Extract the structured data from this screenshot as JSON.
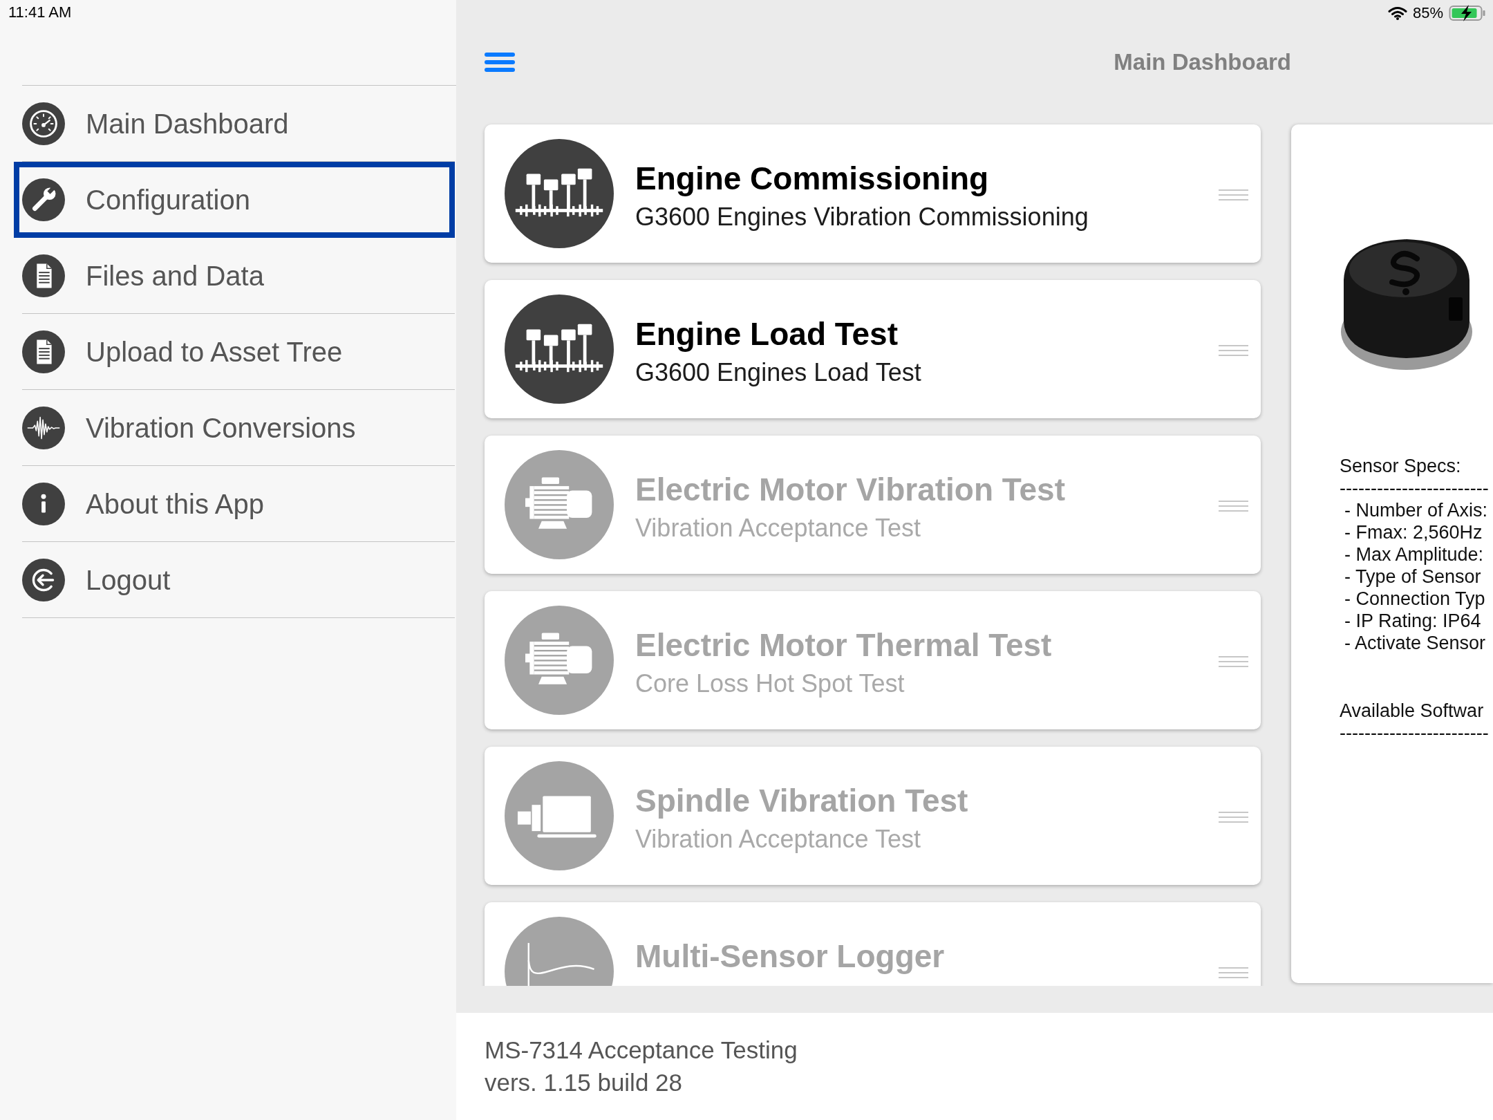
{
  "status_bar": {
    "time": "11:41 AM",
    "battery": "85%"
  },
  "sidebar": {
    "items": [
      {
        "label": "Main Dashboard",
        "kind": "gauge",
        "selected": false
      },
      {
        "label": "Configuration",
        "kind": "wrench",
        "selected": true
      },
      {
        "label": "Files and Data",
        "kind": "document",
        "selected": false
      },
      {
        "label": "Upload to Asset Tree",
        "kind": "document",
        "selected": false
      },
      {
        "label": "Vibration Conversions",
        "kind": "waveform",
        "selected": false
      },
      {
        "label": "About this App",
        "kind": "info",
        "selected": false
      },
      {
        "label": "Logout",
        "kind": "logout",
        "selected": false
      }
    ]
  },
  "header": {
    "title": "Main Dashboard"
  },
  "tests": [
    {
      "title": "Engine Commissioning",
      "subtitle": "G3600 Engines Vibration Commissioning",
      "kind": "engine",
      "disabled": false
    },
    {
      "title": "Engine Load Test",
      "subtitle": "G3600 Engines Load Test",
      "kind": "engine",
      "disabled": false
    },
    {
      "title": "Electric Motor Vibration Test",
      "subtitle": "Vibration Acceptance Test",
      "kind": "motor",
      "disabled": true
    },
    {
      "title": "Electric Motor Thermal Test",
      "subtitle": "Core Loss Hot Spot Test",
      "kind": "motor",
      "disabled": true
    },
    {
      "title": "Spindle Vibration Test",
      "subtitle": "Vibration Acceptance Test",
      "kind": "spindle",
      "disabled": true
    },
    {
      "title": "Multi-Sensor Logger",
      "kind": "logger",
      "disabled": true
    }
  ],
  "sensor_panel": {
    "specs_heading": "Sensor Specs:",
    "specs_rule": "------------------------",
    "specs": [
      "- Number of Axis:",
      "- Fmax: 2,560Hz",
      "- Max Amplitude:",
      "- Type of Sensor",
      "- Connection Typ",
      "- IP Rating: IP64",
      "- Activate Sensor"
    ],
    "software_heading": "Available Softwar",
    "software_rule": "------------------------"
  },
  "footer": {
    "lines": [
      "MS-7314 Acceptance Testing",
      "vers. 1.15 build 28"
    ]
  }
}
